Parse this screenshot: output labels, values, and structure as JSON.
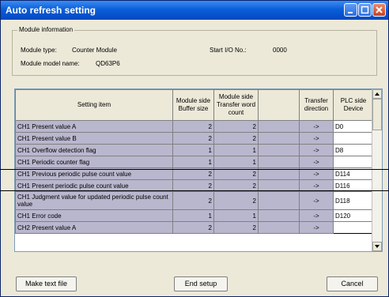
{
  "window": {
    "title": "Auto refresh setting"
  },
  "module_info": {
    "group_label": "Module information",
    "type_label": "Module type:",
    "type_value": "Counter Module",
    "start_io_label": "Start I/O No.:",
    "start_io_value": "0000",
    "model_label": "Module model name:",
    "model_value": "QD63P6"
  },
  "table": {
    "headers": [
      "Setting item",
      "Module side Buffer size",
      "Module side Transfer word count",
      "",
      "Transfer direction",
      "PLC side Device"
    ],
    "rows": [
      {
        "item": "CH1 Present value A",
        "buffer": "2",
        "count": "2",
        "dir": "->",
        "device": "D0"
      },
      {
        "item": "CH1 Present value B",
        "buffer": "2",
        "count": "2",
        "dir": "->",
        "device": ""
      },
      {
        "item": "CH1 Overflow detection flag",
        "buffer": "1",
        "count": "1",
        "dir": "->",
        "device": "D8"
      },
      {
        "item": "CH1 Periodic counter flag",
        "buffer": "1",
        "count": "1",
        "dir": "->",
        "device": ""
      },
      {
        "item": "CH1 Previous periodic pulse count value",
        "buffer": "2",
        "count": "2",
        "dir": "->",
        "device": "D114"
      },
      {
        "item": "CH1 Present periodic pulse count value",
        "buffer": "2",
        "count": "2",
        "dir": "->",
        "device": "D116"
      },
      {
        "item": "CH1 Judgment value for updated periodic pulse count value",
        "buffer": "2",
        "count": "2",
        "dir": "->",
        "device": "D118"
      },
      {
        "item": "CH1 Error code",
        "buffer": "1",
        "count": "1",
        "dir": "->",
        "device": "D120"
      },
      {
        "item": "CH2 Present value A",
        "buffer": "2",
        "count": "2",
        "dir": "->",
        "device": ""
      }
    ]
  },
  "buttons": {
    "make_text_file": "Make text file",
    "end_setup": "End setup",
    "cancel": "Cancel"
  }
}
